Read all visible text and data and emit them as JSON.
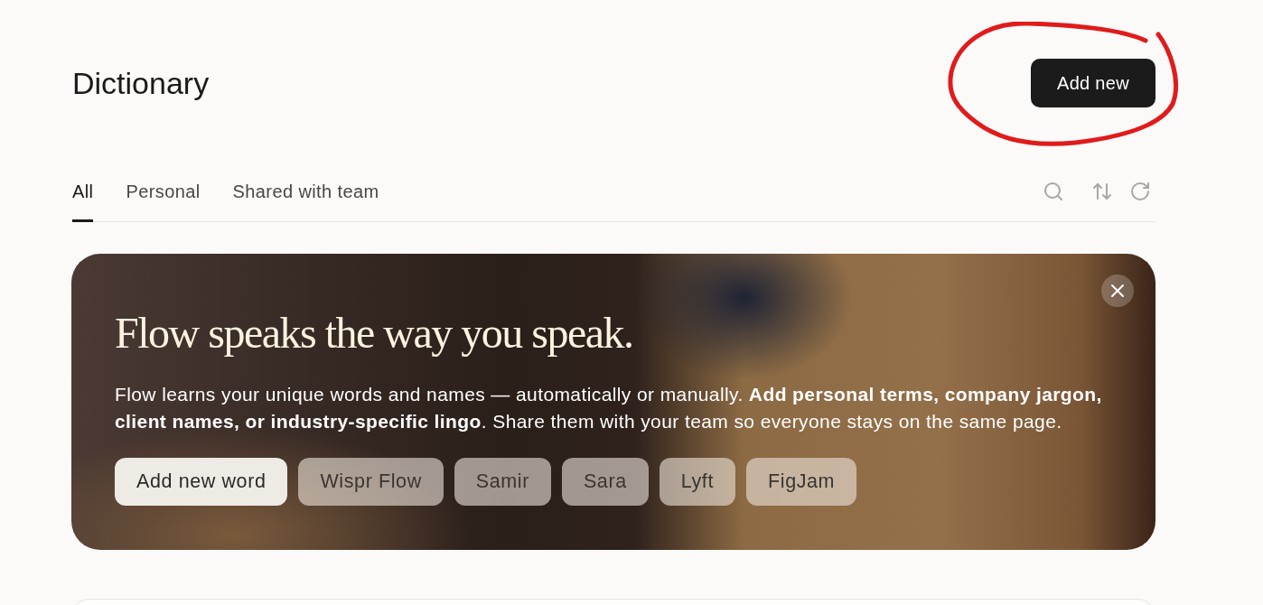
{
  "header": {
    "title": "Dictionary",
    "add_button": "Add new"
  },
  "tabs": [
    {
      "label": "All",
      "selected": true
    },
    {
      "label": "Personal",
      "selected": false
    },
    {
      "label": "Shared with team",
      "selected": false
    }
  ],
  "banner": {
    "headline": "Flow speaks the way you speak.",
    "body": "Flow learns your unique words and names — automatically or manually. **Add personal terms, company jargon, client names, or industry-specific lingo**. Share them with your team so everyone stays on the same page.",
    "chips": [
      {
        "label": "Add new word",
        "kind": "action"
      },
      {
        "label": "Wispr Flow",
        "kind": "word"
      },
      {
        "label": "Samir",
        "kind": "word"
      },
      {
        "label": "Sara",
        "kind": "word"
      },
      {
        "label": "Lyft",
        "kind": "word"
      },
      {
        "label": "FigJam",
        "kind": "word"
      }
    ]
  }
}
